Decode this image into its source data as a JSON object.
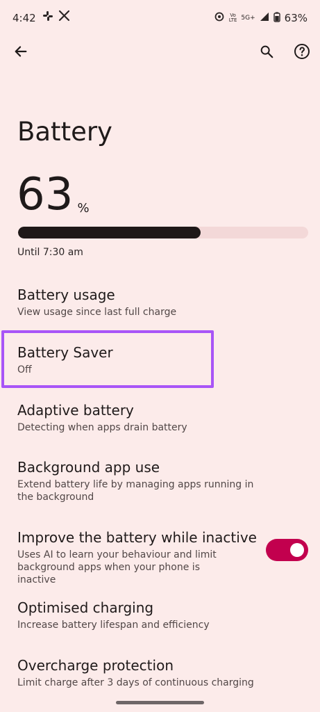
{
  "status_bar": {
    "time": "4:42",
    "left_icons": [
      "slack-icon",
      "x-icon"
    ],
    "network": {
      "volte_top": "Vo",
      "volte_bottom": "LTE",
      "network_type": "5G+"
    },
    "battery_percent": "63%"
  },
  "toolbar": {
    "back_icon": "arrow-back-icon",
    "search_icon": "search-icon",
    "help_icon": "help-circle-icon"
  },
  "page": {
    "title": "Battery",
    "battery_percent_value": "63",
    "battery_percent_sign": "%",
    "battery_level": 0.63,
    "until_text": "Until 7:30 am"
  },
  "settings": [
    {
      "title": "Battery usage",
      "subtitle": "View usage since last full charge"
    },
    {
      "title": "Battery Saver",
      "subtitle": "Off",
      "highlighted": true
    },
    {
      "title": "Adaptive battery",
      "subtitle": "Detecting when apps drain battery"
    },
    {
      "title": "Background app use",
      "subtitle": "Extend battery life by managing apps running in the background"
    },
    {
      "title": "Improve the battery while inactive",
      "subtitle": "Uses AI to learn your behaviour and limit background apps when your phone is inactive",
      "toggle_on": true
    },
    {
      "title": "Optimised charging",
      "subtitle": "Increase battery lifespan and efficiency"
    },
    {
      "title": "Overcharge protection",
      "subtitle": "Limit charge after 3 days of continuous charging"
    }
  ],
  "colors": {
    "background": "#fcebea",
    "accent_toggle": "#c2004e",
    "highlight_border": "#a855f7",
    "battery_fill": "#1e1818",
    "battery_track": "#f3d8d8"
  }
}
